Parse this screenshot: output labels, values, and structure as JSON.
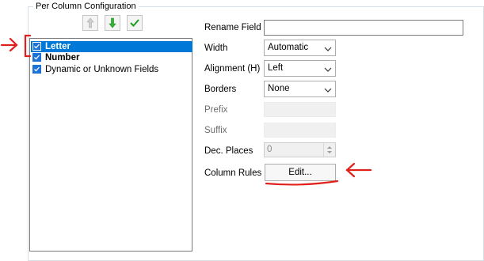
{
  "group": {
    "title": "Per Column Configuration"
  },
  "toolbar": {
    "up_icon": "arrow-up-icon",
    "down_icon": "arrow-down-icon",
    "check_icon": "checkmark-icon"
  },
  "fields_list": [
    {
      "label": "Letter",
      "checked": true,
      "selected": true,
      "bold": true
    },
    {
      "label": "Number",
      "checked": true,
      "selected": false,
      "bold": true
    },
    {
      "label": "Dynamic or Unknown Fields",
      "checked": true,
      "selected": false,
      "bold": false
    }
  ],
  "properties": {
    "rename_field": {
      "label": "Rename Field",
      "value": ""
    },
    "width": {
      "label": "Width",
      "value": "Automatic"
    },
    "alignment": {
      "label": "Alignment (H)",
      "value": "Left"
    },
    "borders": {
      "label": "Borders",
      "value": "None"
    },
    "prefix": {
      "label": "Prefix",
      "value": ""
    },
    "suffix": {
      "label": "Suffix",
      "value": ""
    },
    "dec_places": {
      "label": "Dec. Places",
      "value": "0"
    },
    "column_rules": {
      "label": "Column Rules",
      "button": "Edit..."
    }
  },
  "annotation_color": "#e0201b"
}
